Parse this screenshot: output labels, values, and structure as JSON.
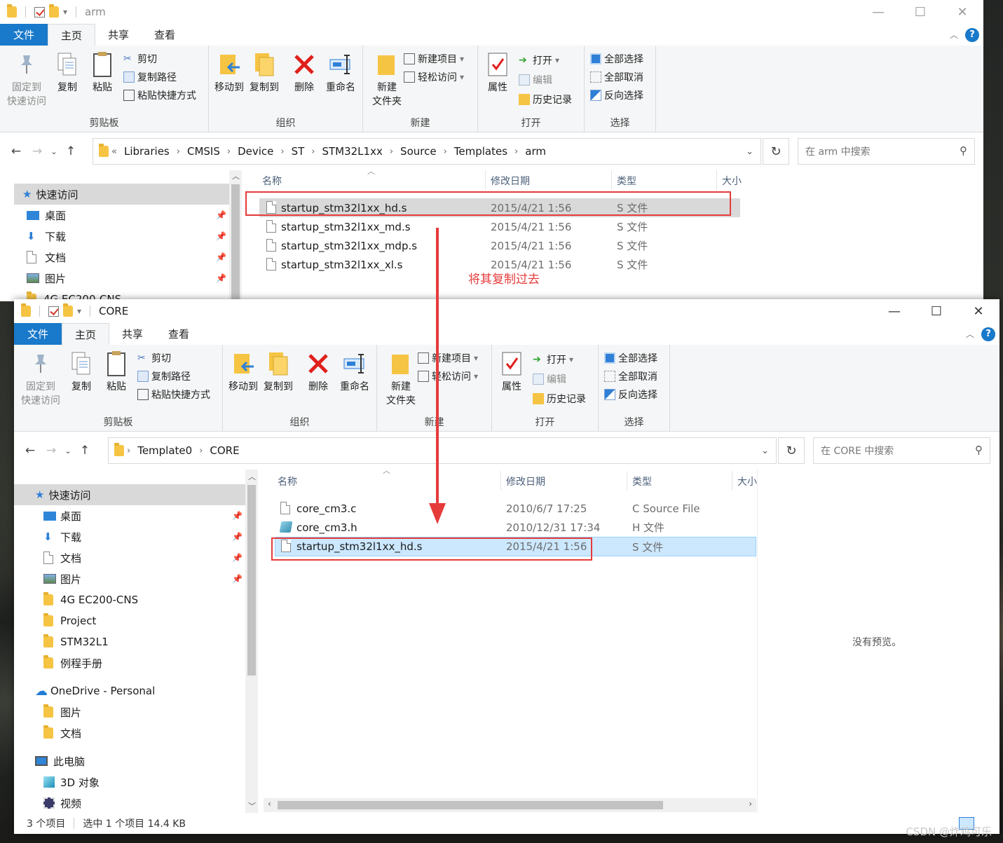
{
  "back_window": {
    "title": "arm",
    "tabs": {
      "file": "文件",
      "home": "主页",
      "share": "共享",
      "view": "查看"
    },
    "ribbon": {
      "pin": "固定到\n快速访问",
      "copy": "复制",
      "paste": "粘贴",
      "cut": "剪切",
      "copy_path": "复制路径",
      "paste_shortcut": "粘贴快捷方式",
      "clipboard": "剪贴板",
      "move_to": "移动到",
      "copy_to": "复制到",
      "delete": "删除",
      "rename": "重命名",
      "organize": "组织",
      "new_folder": "新建\n文件夹",
      "new_item": "新建项目",
      "easy_access": "轻松访问",
      "new": "新建",
      "properties": "属性",
      "open": "打开",
      "edit": "编辑",
      "history": "历史记录",
      "open_group": "打开",
      "select_all": "全部选择",
      "select_none": "全部取消",
      "invert": "反向选择",
      "select": "选择"
    },
    "breadcrumb": [
      "Libraries",
      "CMSIS",
      "Device",
      "ST",
      "STM32L1xx",
      "Source",
      "Templates",
      "arm"
    ],
    "search_placeholder": "在 arm 中搜索",
    "nav": {
      "quick": "快速访问",
      "desktop": "桌面",
      "downloads": "下载",
      "docs": "文档",
      "pictures": "图片",
      "cut_off": "4G EC200-CNS"
    },
    "columns": {
      "name": "名称",
      "date": "修改日期",
      "type": "类型",
      "size": "大小"
    },
    "files": [
      {
        "name": "startup_stm32l1xx_hd.s",
        "date": "2015/4/21 1:56",
        "type": "S 文件"
      },
      {
        "name": "startup_stm32l1xx_md.s",
        "date": "2015/4/21 1:56",
        "type": "S 文件"
      },
      {
        "name": "startup_stm32l1xx_mdp.s",
        "date": "2015/4/21 1:56",
        "type": "S 文件"
      },
      {
        "name": "startup_stm32l1xx_xl.s",
        "date": "2015/4/21 1:56",
        "type": "S 文件"
      }
    ]
  },
  "annotation": {
    "text": "将其复制过去",
    "color": "#e63b3b"
  },
  "front_window": {
    "title": "CORE",
    "breadcrumb": [
      "Template0",
      "CORE"
    ],
    "search_placeholder": "在 CORE 中搜索",
    "nav": [
      {
        "label": "快速访问",
        "icon": "star-icon"
      },
      {
        "label": "桌面",
        "icon": "desktop-icon",
        "pinned": true
      },
      {
        "label": "下载",
        "icon": "download-icon",
        "pinned": true
      },
      {
        "label": "文档",
        "icon": "documents-icon",
        "pinned": true
      },
      {
        "label": "图片",
        "icon": "pictures-icon",
        "pinned": true
      },
      {
        "label": "4G EC200-CNS",
        "icon": "folder-icon"
      },
      {
        "label": "Project",
        "icon": "folder-icon"
      },
      {
        "label": "STM32L1",
        "icon": "folder-icon"
      },
      {
        "label": "例程手册",
        "icon": "folder-icon"
      },
      {
        "label": "OneDrive - Personal",
        "icon": "cloud-icon"
      },
      {
        "label": "图片",
        "icon": "folder-icon"
      },
      {
        "label": "文档",
        "icon": "folder-icon"
      },
      {
        "label": "此电脑",
        "icon": "computer-icon"
      },
      {
        "label": "3D 对象",
        "icon": "cube-icon"
      },
      {
        "label": "视频",
        "icon": "video-icon"
      }
    ],
    "files": [
      {
        "name": "core_cm3.c",
        "date": "2010/6/7 17:25",
        "type": "C Source File"
      },
      {
        "name": "core_cm3.h",
        "date": "2010/12/31 17:34",
        "type": "H 文件"
      },
      {
        "name": "startup_stm32l1xx_hd.s",
        "date": "2015/4/21 1:56",
        "type": "S 文件"
      }
    ],
    "preview": "没有预览。",
    "status": {
      "count": "3 个项目",
      "selected": "选中 1 个项目  14.4 KB"
    }
  },
  "watermark": "CSDN @炸鸡可乐"
}
